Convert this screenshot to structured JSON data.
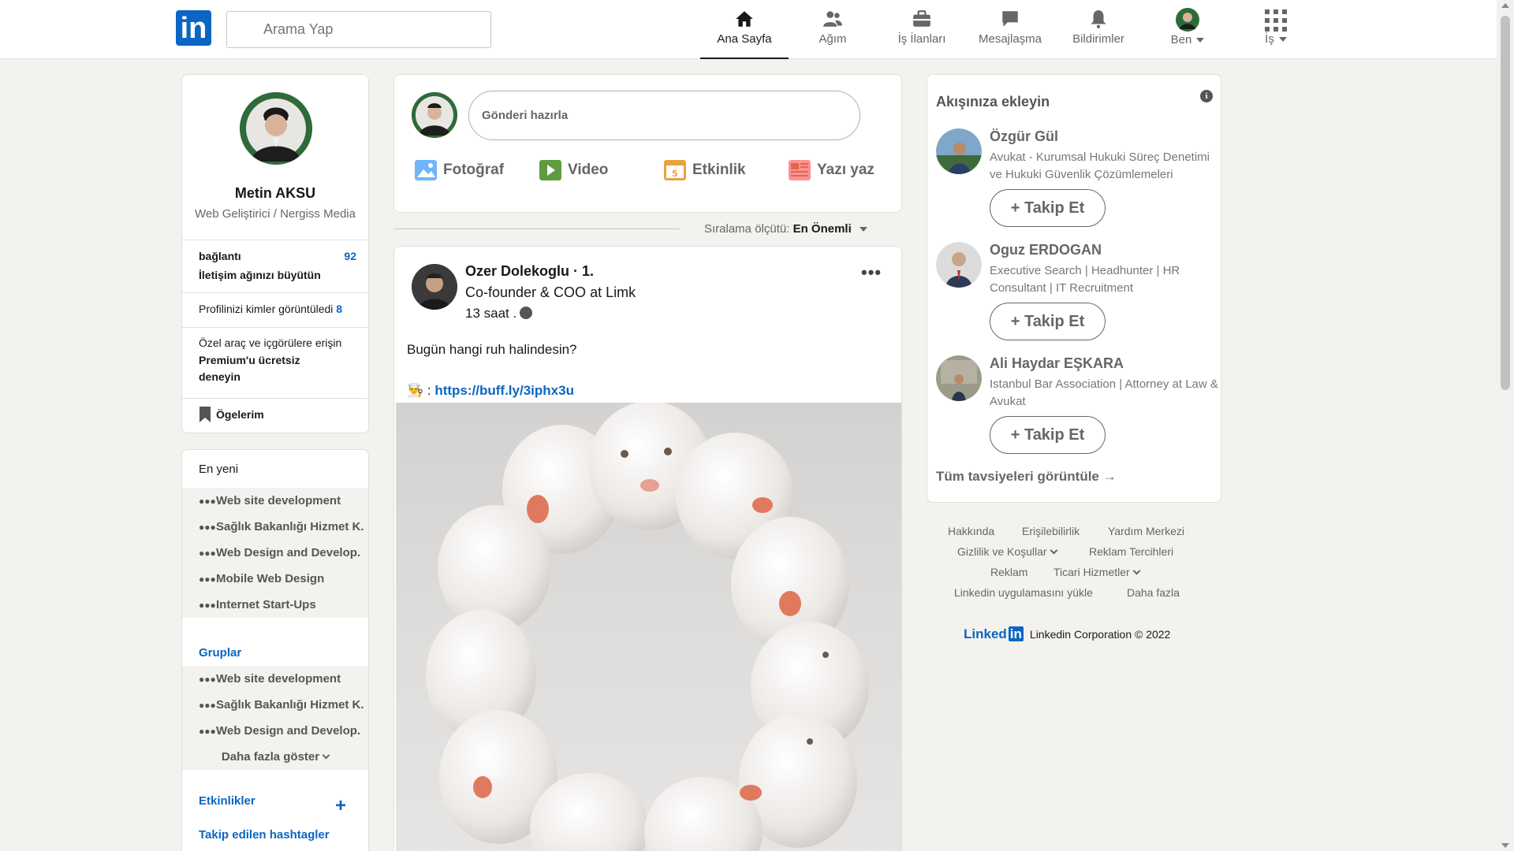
{
  "header": {
    "logo": "in",
    "search_placeholder": "Arama Yap",
    "nav": [
      {
        "label": "Ana Sayfa",
        "icon": "home-icon"
      },
      {
        "label": "Ağım",
        "icon": "network-icon"
      },
      {
        "label": "İş İlanları",
        "icon": "briefcase-icon"
      },
      {
        "label": "Mesajlaşma",
        "icon": "message-icon"
      },
      {
        "label": "Bildirimler",
        "icon": "bell-icon"
      },
      {
        "label": "Ben",
        "icon": "avatar"
      },
      {
        "label": "İş",
        "icon": "grid-icon"
      }
    ]
  },
  "profile": {
    "name": "Metin AKSU",
    "headline": "Web Geliştirici / Nergiss Media",
    "connections_label": "bağlantı",
    "connections_count": "92",
    "grow_network": "İletişim ağınızı büyütün",
    "viewers_label": "Profilinizi kimler görüntüledi",
    "viewers_count": "8",
    "premium_line1": "Özel araç ve içgörülere erişin",
    "premium_line2": "Premium'u ücretsiz",
    "premium_line3": "deneyin",
    "saved_items": "Ögelerim"
  },
  "sidebar": {
    "recent_label": "En yeni",
    "recent": [
      "Web site development",
      "Sağlık Bakanlığı Hizmet K.",
      "Web Design and Develop.",
      "Mobile Web Design",
      "Internet Start-Ups"
    ],
    "groups_label": "Gruplar",
    "groups": [
      "Web site development",
      "Sağlık Bakanlığı Hizmet K.",
      "Web Design and Develop."
    ],
    "show_more": "Daha fazla göster",
    "events_label": "Etkinlikler",
    "plus": "+",
    "hashtags_label": "Takip edilen hashtagler"
  },
  "share": {
    "placeholder": "Gönderi hazırla",
    "photo": "Fotoğraf",
    "video": "Video",
    "event": "Etkinlik",
    "article": "Yazı yaz"
  },
  "sort": {
    "label": "Sıralama ölçütü:",
    "value": "En Önemli"
  },
  "post": {
    "author": "Ozer Dolekoglu · 1.",
    "subtitle": "Co-founder & COO at Limk",
    "time": "13 saat .",
    "more": "•••",
    "text": "Bugün hangi ruh halindesin?",
    "link_prefix": "👨‍🍳 : ",
    "link": "https://buff.ly/3iphx3u"
  },
  "recommendations": {
    "title": "Akışınıza ekleyin",
    "info": "i",
    "people": [
      {
        "name": "Özgür Gül",
        "desc": "Avukat - Kurumsal Hukuki Süreç Denetimi ve Hukuki Güvenlik Çözümlemeleri",
        "button": "+ Takip Et"
      },
      {
        "name": "Oguz ERDOGAN",
        "desc": "Executive Search | Headhunter | HR Consultant | IT Recruitment",
        "button": "+ Takip Et"
      },
      {
        "name": "Ali Haydar EŞKARA",
        "desc": "Istanbul Bar Association | Attorney at Law & Avukat",
        "button": "+ Takip Et"
      }
    ],
    "view_all": "Tüm tavsiyeleri görüntüle →"
  },
  "footer": {
    "about": "Hakkında",
    "accessibility": "Erişilebilirlik",
    "help": "Yardım Merkezi",
    "privacy": "Gizlilik ve Koşullar",
    "ad_prefs": "Reklam Tercihleri",
    "ads": "Reklam",
    "business": "Ticari Hizmetler",
    "get_app": "Linkedin uygulamasını yükle",
    "more": "Daha fazla",
    "logo_text": "Linked",
    "logo_in": "in",
    "copyright": "Linkedin Corporation © 2022"
  },
  "colors": {
    "brand": "#0a66c2",
    "background": "#f3f2ef"
  }
}
